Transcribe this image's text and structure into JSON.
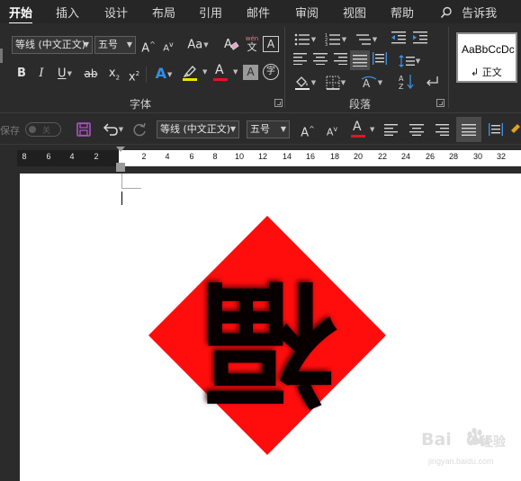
{
  "menu_tabs": [
    {
      "label": "开始",
      "active": true
    },
    {
      "label": "插入"
    },
    {
      "label": "设计"
    },
    {
      "label": "布局"
    },
    {
      "label": "引用"
    },
    {
      "label": "邮件"
    },
    {
      "label": "审阅"
    },
    {
      "label": "视图"
    },
    {
      "label": "帮助"
    }
  ],
  "search": {
    "icon": "lightbulb-icon",
    "label": "告诉我"
  },
  "ribbon": {
    "font_group": {
      "label": "字体",
      "font_name": "等线 (中文正文)",
      "font_size": "五号",
      "grow_font": "A",
      "shrink_font": "A",
      "change_case": "Aa",
      "wen_top": "wén",
      "wen_bottom": "文",
      "bold": "B",
      "italic": "I",
      "underline": "U",
      "strikethrough": "ab",
      "subscript": "x",
      "superscript": "x",
      "text_effects": "A",
      "font_color": "A",
      "char_shading": "A",
      "enclose_char": "字",
      "highlight_color": "#f5e100",
      "font_color_bar": "#e81123"
    },
    "paragraph_group": {
      "label": "段落"
    },
    "styles_group": {
      "sample": "AaBbCcDc",
      "style_name": "↲ 正文"
    }
  },
  "qat": {
    "autosave_label": "保存",
    "autosave_state": "关",
    "font_name": "等线 (中文正文)",
    "font_size": "五号",
    "grow_font": "A",
    "shrink_font": "A",
    "font_color": "A"
  },
  "ruler": {
    "left_numbers": [
      "8",
      "6",
      "4",
      "2"
    ],
    "right_numbers": [
      "2",
      "4",
      "6",
      "8",
      "10",
      "12",
      "14",
      "16",
      "18",
      "20",
      "22",
      "24",
      "26",
      "28",
      "30",
      "32"
    ]
  },
  "document": {
    "image_description_chars": "福",
    "card_color": "#ff0d0d"
  },
  "watermark": {
    "brand": "Bai",
    "brand2": "du",
    "cn": "经验",
    "url": "jingyan.baidu.com"
  }
}
